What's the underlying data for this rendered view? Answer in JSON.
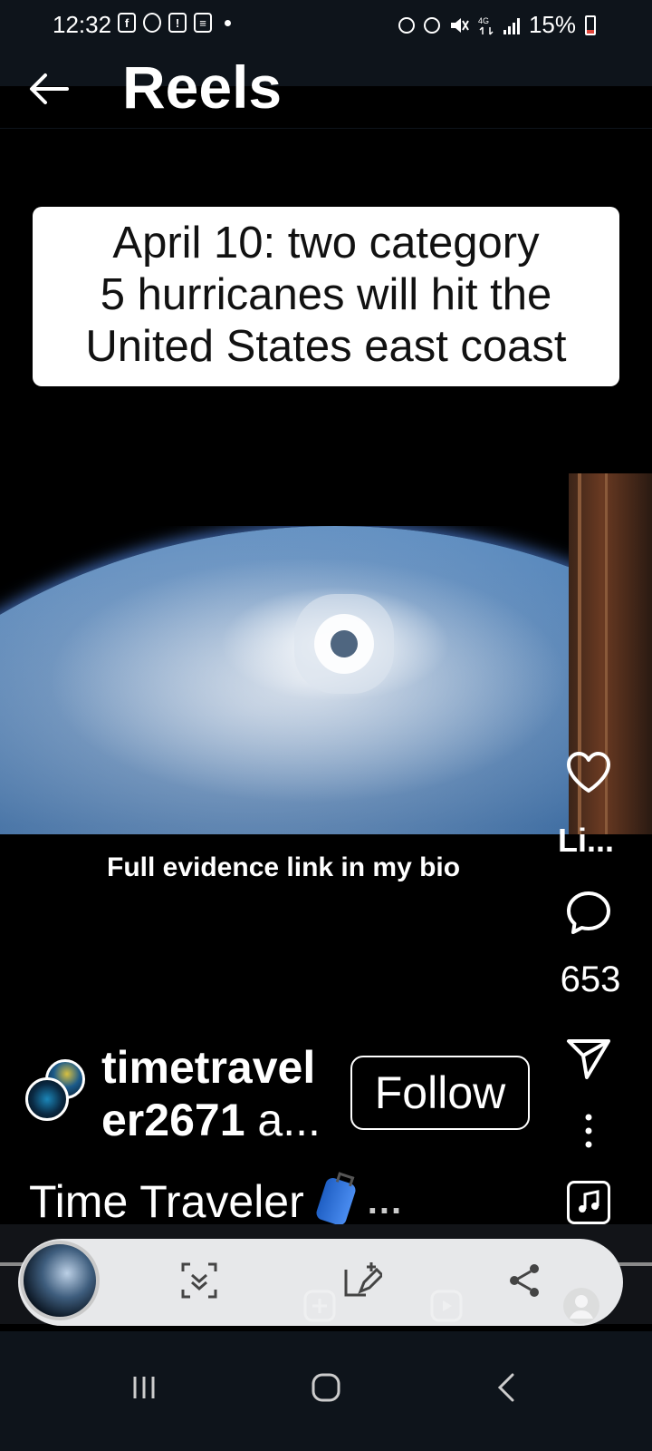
{
  "status_bar": {
    "time": "12:32",
    "battery": "15%",
    "left_icons": [
      "facebook-icon",
      "whatsapp-icon",
      "notification-icon",
      "news-icon"
    ],
    "right_icons": [
      "data-icon",
      "alarm-icon",
      "mute-icon",
      "4g-icon",
      "signal-icon",
      "battery-icon"
    ]
  },
  "header": {
    "title": "Reels"
  },
  "reel": {
    "caption_lines": [
      "April 10: two category",
      "5 hurricanes will hit the",
      "United States east coast"
    ],
    "sub_caption": "Full evidence link in my bio"
  },
  "actions": {
    "like_label": "Li...",
    "comment_count": "653"
  },
  "user": {
    "username_line1": "timetravel",
    "username_line2": "er2671",
    "username_suffix": " a...",
    "follow_label": "Follow",
    "description": "Time Traveler",
    "description_more": "..."
  },
  "colors": {
    "background": "#000000",
    "bar": "#0e141b",
    "tray": "#e7e8ea"
  }
}
